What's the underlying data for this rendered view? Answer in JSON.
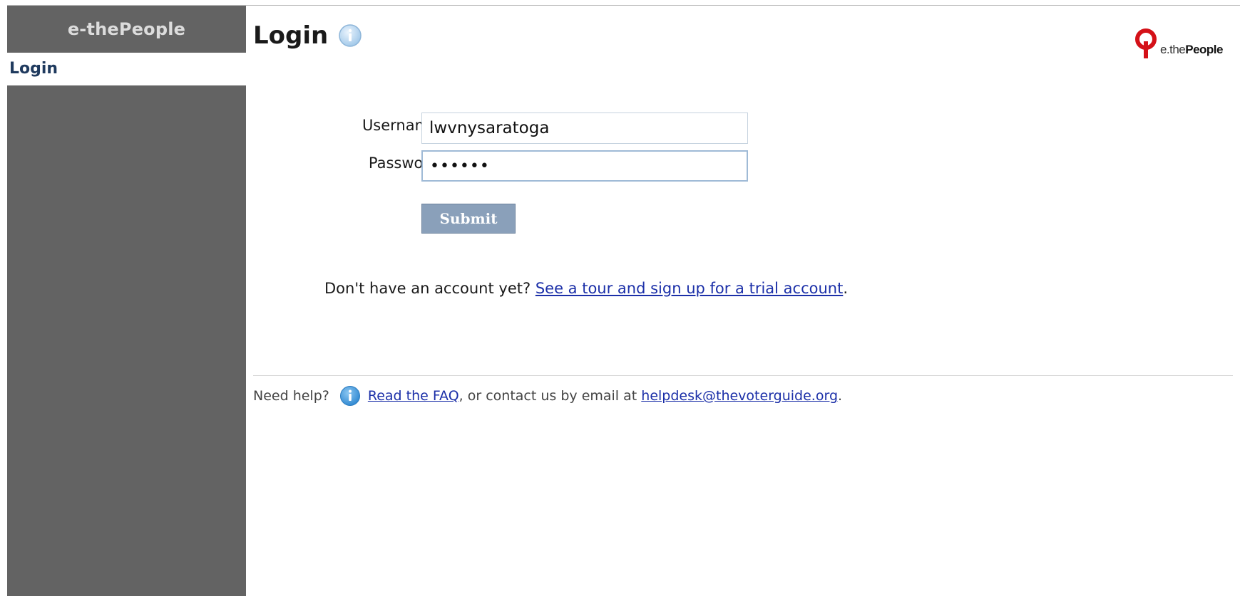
{
  "sidebar": {
    "title": "e-thePeople",
    "items": [
      {
        "label": "Login"
      }
    ]
  },
  "header": {
    "title": "Login",
    "info_icon": "info-icon"
  },
  "logo": {
    "prefix": "e.the",
    "name": "People",
    "mark_color": "#d41118"
  },
  "form": {
    "username_label": "Username",
    "username_value": "lwvnysaratoga",
    "password_label": "Password",
    "password_value": "••••••",
    "submit_label": "Submit"
  },
  "signup": {
    "prompt": "Don't have an account yet?",
    "link_text": "See a tour and sign up for a trial account",
    "suffix": "."
  },
  "help": {
    "prefix": "Need help?",
    "icon": "info-icon",
    "faq_link": "Read the FAQ",
    "middle": ", or contact us by email at",
    "email_link": "helpdesk@thevoterguide.org",
    "suffix": "."
  },
  "colors": {
    "sidebar_bg": "#636363",
    "button_bg": "#8aa0ba",
    "link": "#1b2fa8",
    "brand_red": "#d41118"
  }
}
